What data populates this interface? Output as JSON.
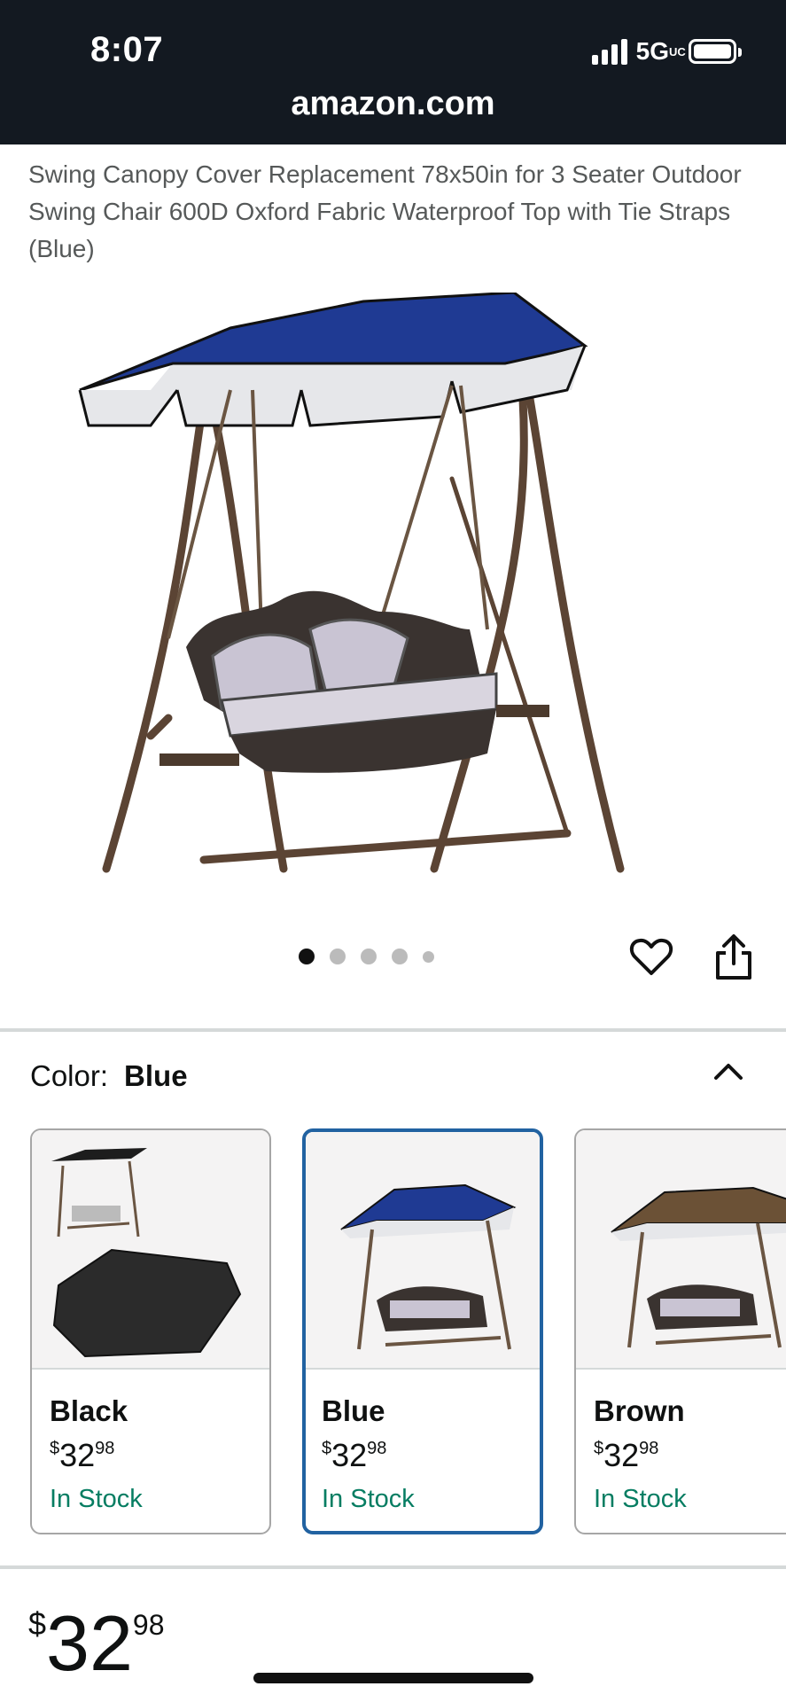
{
  "status_bar": {
    "time": "8:07",
    "network": "5G",
    "network_sup": "UC",
    "url": "amazon.com"
  },
  "product": {
    "title": "Swing Canopy Cover Replacement 78x50in for 3 Seater Outdoor Swing Chair 600D Oxford Fabric Waterproof Top with Tie Straps (Blue)",
    "image_count": 5,
    "active_image": 1
  },
  "actions": {
    "favorite_icon": "heart-icon",
    "share_icon": "share-icon"
  },
  "color_selector": {
    "label": "Color:",
    "selected": "Blue",
    "toggle_icon": "chevron-up-icon",
    "options": [
      {
        "name": "Black",
        "currency": "$",
        "whole": "32",
        "cents": "98",
        "stock": "In Stock",
        "canopy_color": "#1d1d1d"
      },
      {
        "name": "Blue",
        "currency": "$",
        "whole": "32",
        "cents": "98",
        "stock": "In Stock",
        "canopy_color": "#1f3a93"
      },
      {
        "name": "Brown",
        "currency": "$",
        "whole": "32",
        "cents": "98",
        "stock": "In Stock",
        "canopy_color": "#6b5136"
      }
    ]
  },
  "price": {
    "currency": "$",
    "whole": "32",
    "cents": "98"
  },
  "colors": {
    "header_bg": "#131921",
    "in_stock": "#067d62",
    "selected_border": "#2162a1"
  }
}
